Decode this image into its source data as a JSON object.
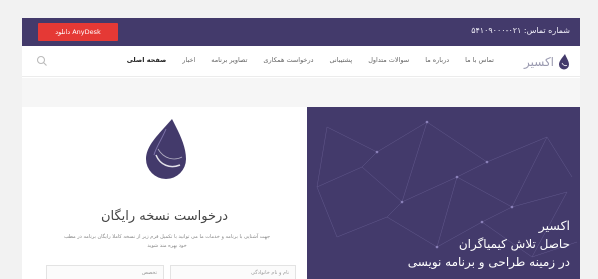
{
  "topbar": {
    "phone": "شماره تماس: ۰۲۱-۵۴۱۰۹۰۰۰",
    "anydesk_label": "دانلود AnyDesk"
  },
  "logo": {
    "text": "اکسیر"
  },
  "nav": {
    "items": [
      {
        "label": "صفحه اصلی"
      },
      {
        "label": "اخبار"
      },
      {
        "label": "تصاویر برنامه"
      },
      {
        "label": "درخواست همکاری"
      },
      {
        "label": "پشتیبانی"
      },
      {
        "label": "سوالات متداول"
      },
      {
        "label": "درباره ما"
      },
      {
        "label": "تماس با ما"
      }
    ]
  },
  "hero": {
    "line1": "اکسیر",
    "line2": "حاصل تلاش کیمیاگران",
    "line3": "در زمینه طراحی و برنامه نویسی"
  },
  "request": {
    "title": "درخواست نسخه رایگان",
    "description": "جهت آشنایی با برنامه و خدمات ما می توانید با تکمیل فرم زیر از نسخه کاملا رایگان برنامه در مطب خود بهره مند شوید",
    "name_placeholder": "نام و نام خانوادگی",
    "specialty_placeholder": "تخصص"
  },
  "colors": {
    "brand_purple": "#433a6b",
    "anydesk_red": "#e53935"
  }
}
